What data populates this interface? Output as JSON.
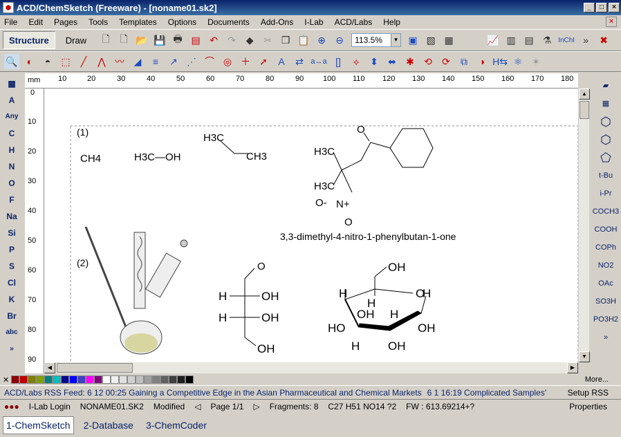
{
  "window": {
    "title": "ACD/ChemSketch (Freeware) - [noname01.sk2]"
  },
  "menu": [
    "File",
    "Edit",
    "Pages",
    "Tools",
    "Templates",
    "Options",
    "Documents",
    "Add-Ons",
    "I-Lab",
    "ACD/Labs",
    "Help"
  ],
  "toolbar": {
    "structure": "Structure",
    "draw": "Draw",
    "zoom": "113.5%",
    "inchi": "InChI"
  },
  "left_elements": [
    "A",
    "Any",
    "C",
    "H",
    "N",
    "O",
    "F",
    "Na",
    "Si",
    "P",
    "S",
    "Cl",
    "K",
    "Br"
  ],
  "right_groups": [
    "t-Bu",
    "i-Pr",
    "COCH3",
    "COOH",
    "COPh",
    "NO2",
    "OAc",
    "SO3H",
    "PO3H2"
  ],
  "ruler": {
    "unit": "mm",
    "top": [
      "10",
      "20",
      "30",
      "40",
      "50",
      "60",
      "70",
      "80",
      "90",
      "100",
      "110",
      "120",
      "130",
      "140",
      "150",
      "160",
      "170",
      "180"
    ],
    "left": [
      "0",
      "10",
      "20",
      "30",
      "40",
      "50",
      "60",
      "70",
      "80",
      "90"
    ]
  },
  "canvas": {
    "label1": "(1)",
    "label2": "(2)",
    "methane": "CH4",
    "methanol": "H3C—OH",
    "propane_h3c": "H3C",
    "propane_ch3": "CH3",
    "nitro_name": "3,3-dimethyl-4-nitro-1-phenylbutan-1-one",
    "h3c1": "H3C",
    "h3c2": "H3C",
    "o_top": "O",
    "n": "N+",
    "o_minus": "O-",
    "o_bot": "O",
    "glyc_o": "O",
    "glyc_h1": "H",
    "glyc_oh1": "OH",
    "glyc_h2": "H",
    "glyc_oh2": "OH",
    "glyc_oh3": "OH",
    "glu_oh1": "OH",
    "glu_h1": "H",
    "glu_o": "O",
    "glu_h2": "H",
    "glu_h3": "H",
    "glu_oh2": "OH",
    "glu_oh3": "OH",
    "glu_h4": "H",
    "glu_ho": "HO",
    "glu_h5": "H",
    "glu_oh4": "OH"
  },
  "palette": {
    "more": "More..."
  },
  "rss": {
    "feed": "ACD/Labs RSS Feed: 6 12 00:25 Gaining a Competitive Edge in the Asian Pharmaceutical and Chemical Markets",
    "feed2": "6 1 16:19 Complicated Samples'",
    "setup": "Setup RSS"
  },
  "status": {
    "ilab": "I-Lab Login",
    "file": "NONAME01.SK2",
    "modified": "Modified",
    "page": "Page 1/1",
    "fragments": "Fragments: 8",
    "formula": "C27 H51 NO14 ?2",
    "fw": "FW : 613.69214+?",
    "properties": "Properties"
  },
  "tabs": [
    "1-ChemSketch",
    "2-Database",
    "3-ChemCoder"
  ]
}
